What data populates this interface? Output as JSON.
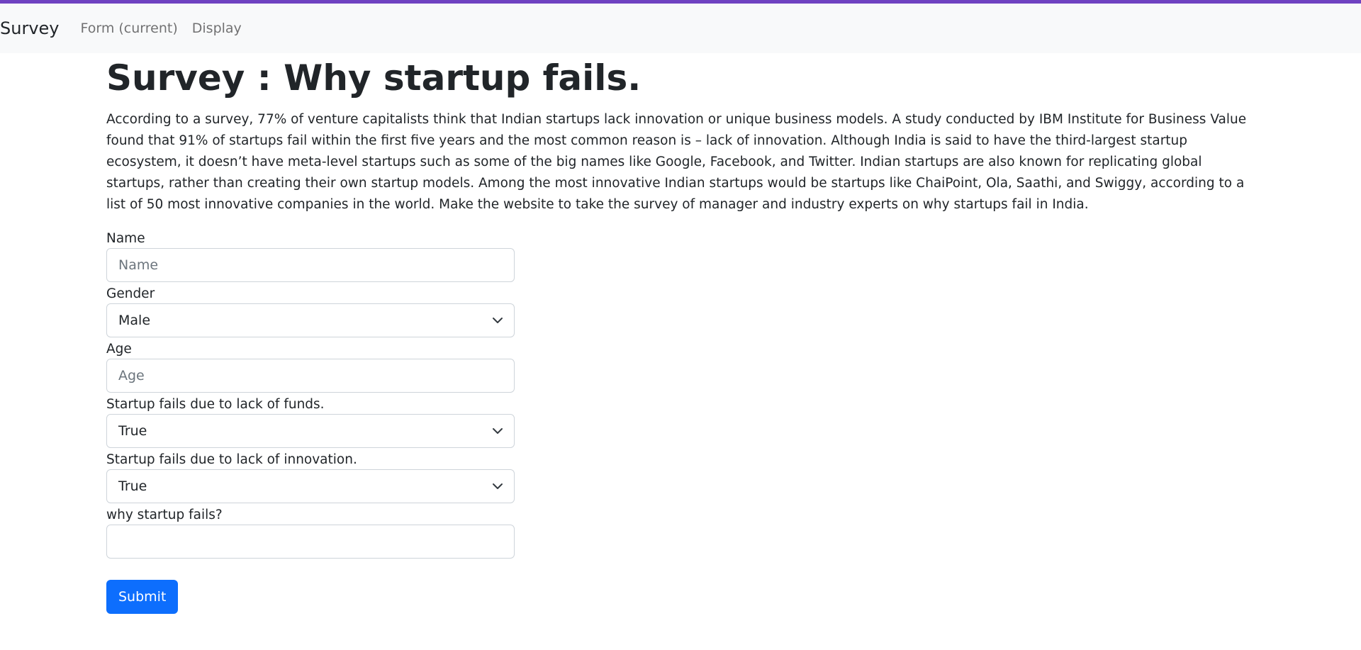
{
  "navbar": {
    "brand": "Survey",
    "links": [
      "Form (current)",
      "Display"
    ]
  },
  "page": {
    "title": "Survey : Why startup fails.",
    "intro": "According to a survey, 77% of venture capitalists think that Indian startups lack innovation or unique business models. A study conducted by IBM Institute for Business Value found that 91% of startups fail within the first five years and the most common reason is – lack of innovation. Although India is said to have the third-largest startup ecosystem, it doesn’t have meta-level startups such as some of the big names like Google, Facebook, and Twitter. Indian startups are also known for replicating global startups, rather than creating their own startup models. Among the most innovative Indian startups would be startups like ChaiPoint, Ola, Saathi, and Swiggy, according to a list of 50 most innovative companies in the world. Make the website to take the survey of manager and industry experts on why startups fail in India."
  },
  "form": {
    "name": {
      "label": "Name",
      "placeholder": "Name",
      "value": ""
    },
    "gender": {
      "label": "Gender",
      "value": "Male"
    },
    "age": {
      "label": "Age",
      "placeholder": "Age",
      "value": ""
    },
    "funds": {
      "label": "Startup fails due to lack of funds.",
      "value": "True"
    },
    "innovation": {
      "label": "Startup fails due to lack of innovation.",
      "value": "True"
    },
    "why": {
      "label": "why startup fails?",
      "value": ""
    },
    "submit_label": "Submit"
  },
  "colors": {
    "accent": "#6f42c1",
    "primary": "#0d6efd",
    "navbar_bg": "#f8f9fa"
  },
  "icons": {
    "select_indicator": "chevron-down-icon"
  }
}
